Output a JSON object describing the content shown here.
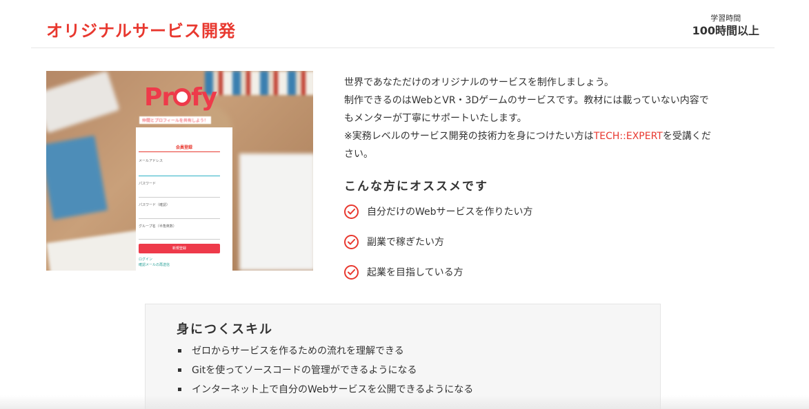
{
  "header": {
    "title": "オリジナルサービス開発",
    "study_label": "学習時間",
    "study_value": "100時間以上"
  },
  "thumbnail": {
    "logo_text_1": "Pr",
    "logo_text_2": "fy",
    "logo_sub": "仲間とプロフィールを共有しよう！",
    "form": {
      "title": "会員登録",
      "email_label": "メールアドレス",
      "password_label": "パスワード",
      "password_confirm_label": "パスワード（確認）",
      "group_label": "グループ名（半角英数）",
      "submit_label": "新規登録",
      "login_link": "ログイン",
      "resend_link": "確認メールの再送信"
    }
  },
  "description": {
    "line1": "世界であなただけのオリジナルのサービスを制作しましょう。",
    "line2": "制作できるのはWebとVR・3Dゲームのサービスです。教材には載っていない内容で",
    "line3": "もメンターが丁寧にサポートいたします。",
    "line4_pre": "※実務レベルのサービス開発の技術力を身につけたい方は",
    "line4_link": "TECH::EXPERT",
    "line4_post": "を受講くだ",
    "line5": "さい。"
  },
  "recommend": {
    "title": "こんな方にオススメです",
    "items": [
      "自分だけのWebサービスを作りたい方",
      "副業で稼ぎたい方",
      "起業を目指している方"
    ]
  },
  "skills": {
    "title": "身につくスキル",
    "items": [
      "ゼロからサービスを作るための流れを理解できる",
      "Gitを使ってソースコードの管理ができるようになる",
      "インターネット上で自分のWebサービスを公開できるようになる"
    ]
  },
  "colors": {
    "accent": "#e8382f",
    "text": "#333333",
    "skills_bg": "#f6f6f6"
  },
  "icons": {
    "check": "check-circle-icon"
  }
}
